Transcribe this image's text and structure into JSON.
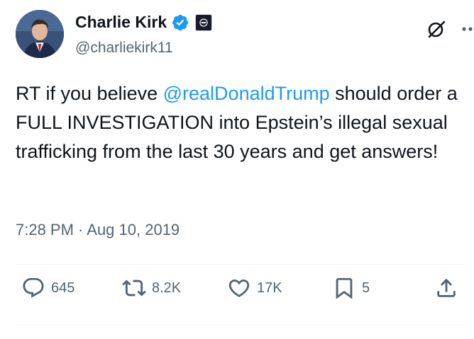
{
  "author": {
    "display_name": "Charlie Kirk",
    "handle": "@charliekirk11",
    "verified": true
  },
  "tweet": {
    "text_before": "RT if you believe ",
    "mention": "@realDonaldTrump",
    "text_after": " should order a FULL INVESTIGATION into Epstein’s illegal sexual trafficking from the last 30 years and get answers!",
    "timestamp": "7:28 PM · Aug 10, 2019"
  },
  "actions": {
    "replies": "645",
    "reposts": "8.2K",
    "likes": "17K",
    "bookmarks": "5"
  },
  "colors": {
    "accent": "#1d9bf0",
    "secondary_text": "#536471",
    "primary_text": "#0f1419"
  },
  "icons": [
    "verified-badge-icon",
    "affiliate-badge-icon",
    "grok-icon",
    "more-icon",
    "reply-icon",
    "repost-icon",
    "like-icon",
    "bookmark-icon",
    "share-icon"
  ]
}
